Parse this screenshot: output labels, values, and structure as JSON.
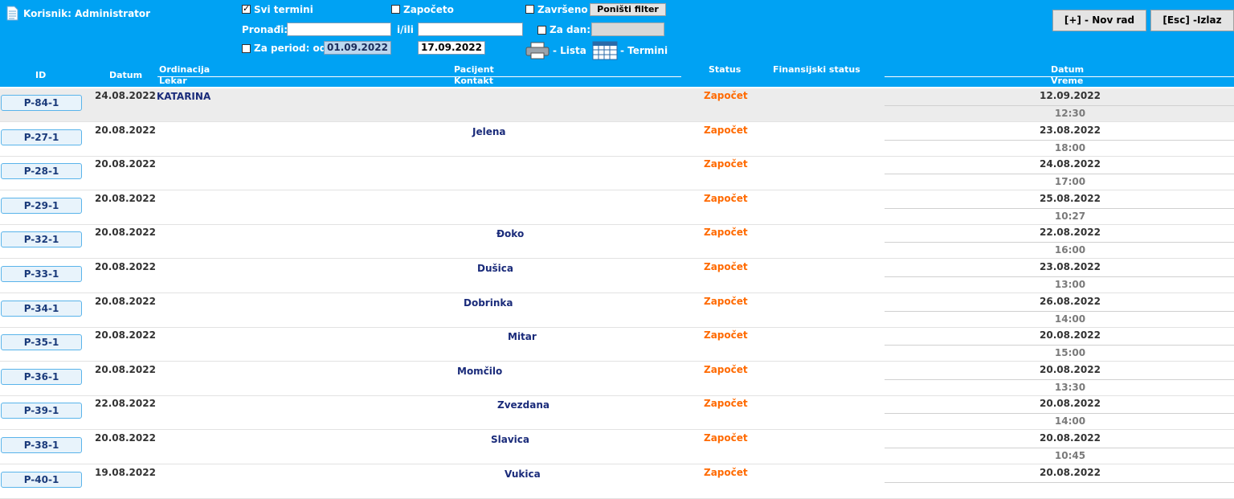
{
  "header": {
    "user_label": "Korisnik: Administrator",
    "filters": {
      "all_label": "Svi termini",
      "started_label": "Započeto",
      "finished_label": "Završeno",
      "reset_label": "Poništi filter",
      "find_label": "Pronađi:",
      "find_value": "",
      "andor_label": "i/ili",
      "andor_value": "",
      "for_day_label": "Za dan:",
      "for_day_value": "",
      "period_label": "Za period: od",
      "period_from": "01.09.2022",
      "period_to": "17.09.2022",
      "list_label": "- Lista",
      "appointments_label": "- Termini"
    },
    "new_button": "[+] - Nov rad",
    "exit_button": "[Esc] -Izlaz"
  },
  "columns": {
    "id": "ID",
    "date": "Datum",
    "office": "Ordinacija",
    "doctor": "Lekar",
    "patient": "Pacijent",
    "contact": "Kontakt",
    "status": "Status",
    "finance": "Finansijski status",
    "right_date": "Datum",
    "right_time": "Vreme"
  },
  "rows": [
    {
      "id": "P-84-1",
      "date": "24.08.2022",
      "doctor": "KATARINA",
      "patient": "",
      "status": "Započet",
      "appt_date": "12.09.2022",
      "appt_time": "12:30"
    },
    {
      "id": "P-27-1",
      "date": "20.08.2022",
      "doctor": "",
      "patient": "Jelena",
      "status": "Započet",
      "appt_date": "23.08.2022",
      "appt_time": "18:00"
    },
    {
      "id": "P-28-1",
      "date": "20.08.2022",
      "doctor": "",
      "patient": "",
      "status": "Započet",
      "appt_date": "24.08.2022",
      "appt_time": "17:00"
    },
    {
      "id": "P-29-1",
      "date": "20.08.2022",
      "doctor": "",
      "patient": "",
      "status": "Započet",
      "appt_date": "25.08.2022",
      "appt_time": "10:27"
    },
    {
      "id": "P-32-1",
      "date": "20.08.2022",
      "doctor": "",
      "patient": "Đoko",
      "status": "Započet",
      "appt_date": "22.08.2022",
      "appt_time": "16:00"
    },
    {
      "id": "P-33-1",
      "date": "20.08.2022",
      "doctor": "",
      "patient": "Dušica",
      "status": "Započet",
      "appt_date": "23.08.2022",
      "appt_time": "13:00"
    },
    {
      "id": "P-34-1",
      "date": "20.08.2022",
      "doctor": "",
      "patient": "Dobrinka",
      "status": "Započet",
      "appt_date": "26.08.2022",
      "appt_time": "14:00"
    },
    {
      "id": "P-35-1",
      "date": "20.08.2022",
      "doctor": "",
      "patient": "Mitar",
      "status": "Započet",
      "appt_date": "20.08.2022",
      "appt_time": "15:00"
    },
    {
      "id": "P-36-1",
      "date": "20.08.2022",
      "doctor": "",
      "patient": "Momčilo",
      "status": "Započet",
      "appt_date": "20.08.2022",
      "appt_time": "13:30"
    },
    {
      "id": "P-39-1",
      "date": "22.08.2022",
      "doctor": "",
      "patient": "Zvezdana",
      "status": "Započet",
      "appt_date": "20.08.2022",
      "appt_time": "14:00"
    },
    {
      "id": "P-38-1",
      "date": "20.08.2022",
      "doctor": "",
      "patient": "Slavica",
      "status": "Započet",
      "appt_date": "20.08.2022",
      "appt_time": "10:45"
    },
    {
      "id": "P-40-1",
      "date": "19.08.2022",
      "doctor": "",
      "patient": "Vukica",
      "status": "Započet",
      "appt_date": "20.08.2022",
      "appt_time": ""
    }
  ],
  "colors": {
    "header_bg": "#00a2f3",
    "status": "#ff6a00",
    "id_border": "#5ab4ea"
  }
}
